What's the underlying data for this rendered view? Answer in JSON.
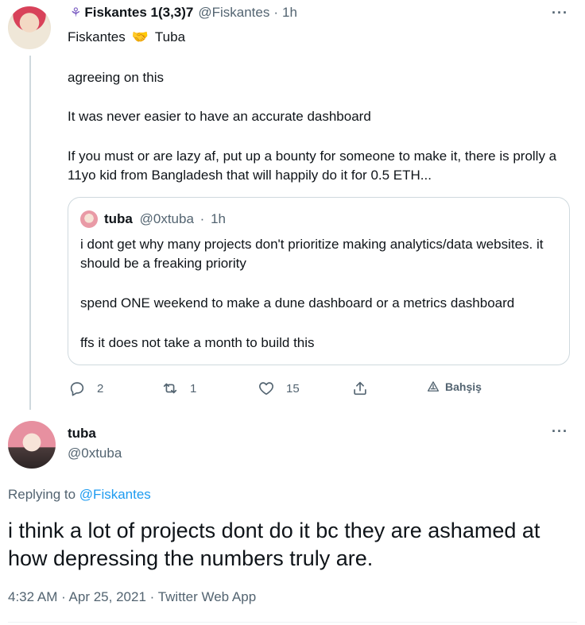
{
  "parent_tweet": {
    "display_name": "Fiskantes 1(3,3)7",
    "handle": "@Fiskantes",
    "time": "1h",
    "badge_glyph": "⚘",
    "separator": "·",
    "names_left": "Fiskantes",
    "names_right": "Tuba",
    "handshake_glyph": "🤝",
    "more": "···",
    "paragraphs": [
      "agreeing on this",
      "It was never easier to have an accurate dashboard",
      "If you must or are lazy af, put up a bounty for someone to make it, there is prolly a 11yo kid from Bangladesh that will happily do it for 0.5 ETH..."
    ],
    "quote": {
      "display_name": "tuba",
      "handle": "@0xtuba",
      "time": "1h",
      "separator": "·",
      "paragraphs": [
        "i dont get why many projects don't prioritize making analytics/data websites. it should be a freaking priority",
        "spend ONE weekend to make a dune dashboard or a metrics dashboard",
        "ffs it does not take a month to build this"
      ]
    },
    "actions": {
      "reply_count": "2",
      "retweet_count": "1",
      "like_count": "15",
      "tip_label": "Bahşiş",
      "icons": [
        "reply-icon",
        "retweet-icon",
        "like-icon",
        "share-icon",
        "tip-icon"
      ]
    }
  },
  "main_tweet": {
    "display_name": "tuba",
    "handle": "@0xtuba",
    "more": "···",
    "replying_prefix": "Replying to",
    "replying_to": "@Fiskantes",
    "text": "i think a lot of projects dont do it bc they are ashamed at how depressing the numbers truly are.",
    "meta": "4:32 AM · Apr 25, 2021 · Twitter Web App"
  },
  "colors": {
    "text": "#0f1419",
    "secondary": "#536471",
    "link": "#1d9bf0",
    "border": "#cfd9de"
  }
}
